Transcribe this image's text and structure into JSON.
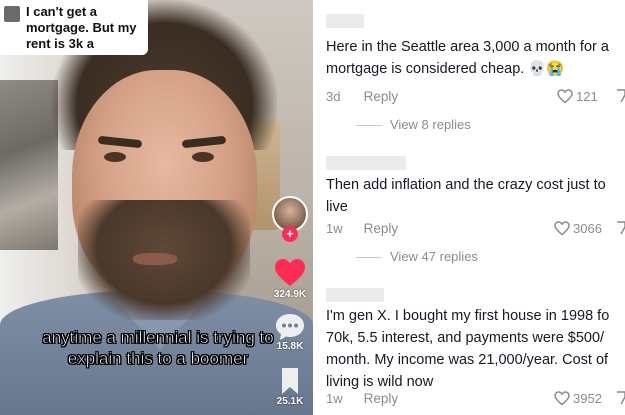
{
  "video": {
    "sticker": {
      "text": "I can't get a mortgage. But my rent is 3k a"
    },
    "caption": "anytime a millennial is trying to explain this to a boomer",
    "rail": {
      "likes": "324.9K",
      "comments": "15.8K",
      "saves": "25.1K"
    },
    "colors": {
      "like": "#fe2c55",
      "follow": "#fe2c55"
    },
    "icons": [
      "heart-icon",
      "comment-bubble-icon",
      "bookmark-icon",
      "follow-plus-icon"
    ]
  },
  "comments": [
    {
      "text": "Here in the Seattle area 3,000 a month for a mortgage is considered cheap. 💀😭",
      "time": "3d",
      "reply": "Reply",
      "likes": "121",
      "view_replies": "View 8 replies"
    },
    {
      "text": "Then add inflation and the crazy cost just to live",
      "time": "1w",
      "reply": "Reply",
      "likes": "3066",
      "view_replies": "View 47 replies"
    },
    {
      "text": "I'm gen X. I bought my first house in 1998 fo 70k, 5.5 interest, and payments were $500/ month. My income was 21,000/year. Cost of living is wild now",
      "time": "1w",
      "reply": "Reply",
      "likes": "3952"
    }
  ]
}
